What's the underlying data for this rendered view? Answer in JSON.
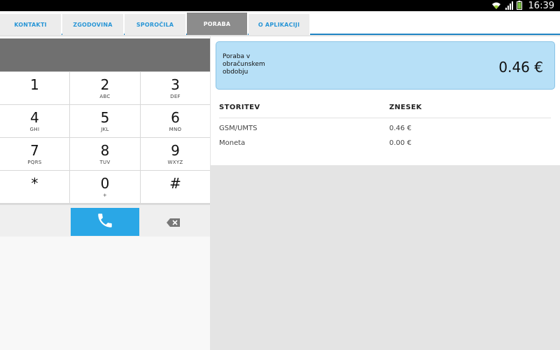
{
  "statusbar": {
    "time": "16:39",
    "icons": [
      "wifi-icon",
      "signal-icon",
      "battery-icon"
    ]
  },
  "tabs": [
    {
      "label": "KONTAKTI",
      "active": false
    },
    {
      "label": "ZGODOVINA",
      "active": false
    },
    {
      "label": "SPOROČILA",
      "active": false
    },
    {
      "label": "PORABA",
      "active": true
    },
    {
      "label": "O APLIKACIJI",
      "active": false
    }
  ],
  "dialer": {
    "keys": [
      {
        "digit": "1",
        "letters": ""
      },
      {
        "digit": "2",
        "letters": "ABC"
      },
      {
        "digit": "3",
        "letters": "DEF"
      },
      {
        "digit": "4",
        "letters": "GHI"
      },
      {
        "digit": "5",
        "letters": "JKL"
      },
      {
        "digit": "6",
        "letters": "MNO"
      },
      {
        "digit": "7",
        "letters": "PQRS"
      },
      {
        "digit": "8",
        "letters": "TUV"
      },
      {
        "digit": "9",
        "letters": "WXYZ"
      },
      {
        "digit": "*",
        "letters": ""
      },
      {
        "digit": "0",
        "letters": "+"
      },
      {
        "digit": "#",
        "letters": ""
      }
    ],
    "call_icon": "phone-icon",
    "delete_icon": "backspace-icon",
    "accent_color": "#2aa7e6"
  },
  "usage": {
    "label": "Poraba v\nobračunskem\nobdobju",
    "total": "0.46 €",
    "card_color": "#b7e0f7"
  },
  "table": {
    "headers": [
      "STORITEV",
      "ZNESEK"
    ],
    "rows": [
      [
        "GSM/UMTS",
        "0.46 €"
      ],
      [
        "Moneta",
        "0.00 €"
      ]
    ]
  }
}
